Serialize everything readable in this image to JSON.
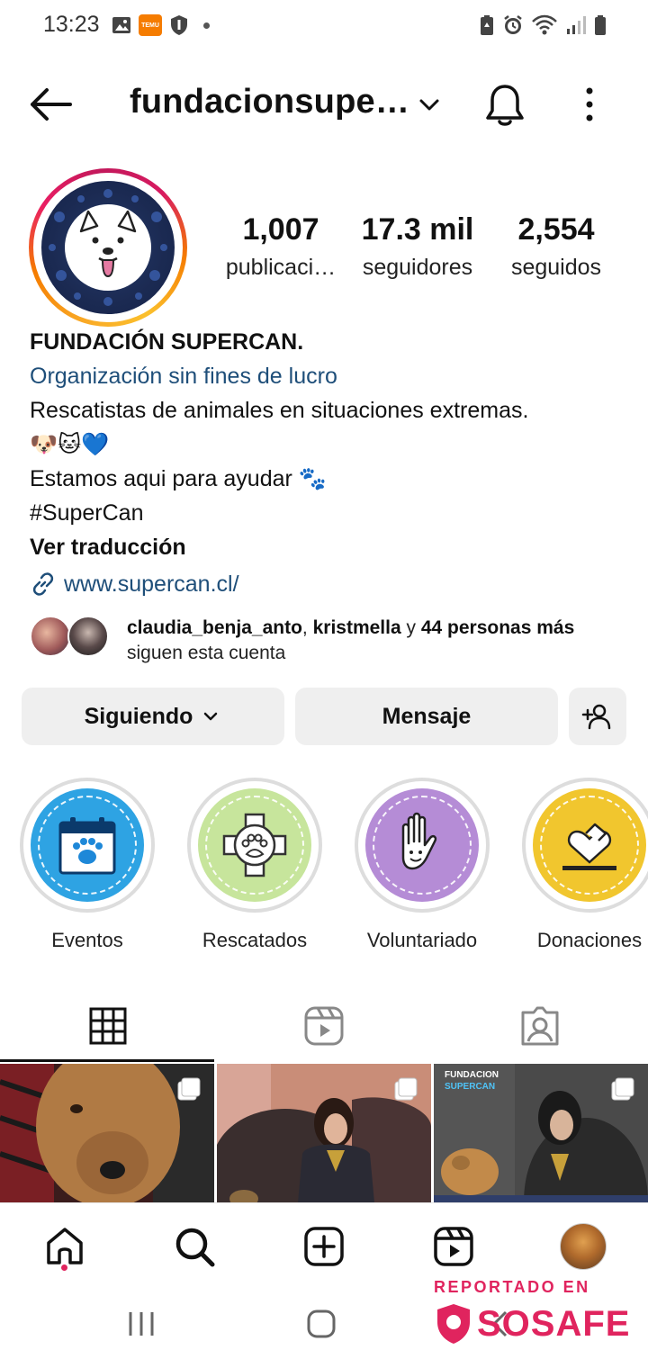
{
  "status_bar": {
    "time": "13:23",
    "temu_badge": "TEMU"
  },
  "header": {
    "username": "fundacionsupe…"
  },
  "profile": {
    "stats": [
      {
        "value": "1,007",
        "label": "publicaci…"
      },
      {
        "value": "17.3 mil",
        "label": "seguidores"
      },
      {
        "value": "2,554",
        "label": "seguidos"
      }
    ],
    "bio": {
      "name": "FUNDACIÓN SUPERCAN.",
      "category": "Organización sin fines de lucro",
      "line1": "Rescatistas de animales en situaciones extremas.",
      "emojis": "🐶🐱💙",
      "line2": "Estamos aqui para ayudar 🐾",
      "hashtag": "#SuperCan",
      "translate": "Ver traducción",
      "link": "www.supercan.cl/"
    },
    "followed_by": {
      "user1": "claudia_benja_anto",
      "sep": ",",
      "user2": "kristmella",
      "and": "y",
      "others": "44 personas más",
      "suffix": "siguen esta cuenta"
    }
  },
  "actions": {
    "following": "Siguiendo",
    "message": "Mensaje"
  },
  "highlights": [
    {
      "label": "Eventos",
      "color": "#2ea3e3"
    },
    {
      "label": "Rescatados",
      "color": "#c7e59c"
    },
    {
      "label": "Voluntariado",
      "color": "#b58cd6"
    },
    {
      "label": "Donaciones",
      "color": "#f1c62e"
    }
  ],
  "posts": [
    {
      "brand": ""
    },
    {
      "brand": ""
    },
    {
      "brand_top": "FUNDACION",
      "brand_bottom": "SUPERCAN"
    }
  ],
  "watermark": {
    "top": "REPORTADO EN",
    "brand": "SOSAFE"
  },
  "colors": {
    "link_blue": "#1e4e79",
    "accent_pink": "#e0245e"
  }
}
